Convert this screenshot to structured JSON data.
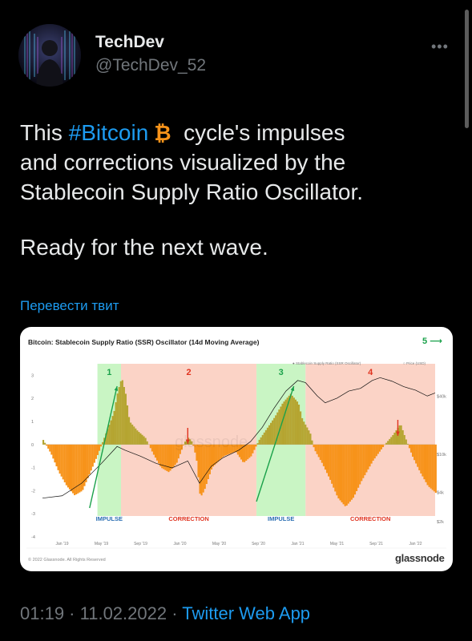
{
  "author": {
    "display_name": "TechDev",
    "handle": "@TechDev_52",
    "avatar_icon": "avatar-photo"
  },
  "tweet": {
    "line1_before": "This ",
    "hashtag": "#Bitcoin",
    "line1_after": " cycle's impulses",
    "line2": "and corrections visualized by the",
    "line3": "Stablecoin Supply Ratio Oscillator.",
    "paragraph2": "Ready for the next wave.",
    "translate_label": "Перевести твит",
    "emoji_icon": "bitcoin-icon"
  },
  "footer": {
    "time": "01:19",
    "separator": " · ",
    "date": "11.02.2022",
    "app": "Twitter Web App"
  },
  "colors": {
    "accent": "#1d9bf0",
    "impulse_bg": "#c9f5c4",
    "correction_bg": "#fbd3c6",
    "bar_orange": "#f7931a",
    "bar_olive": "#b5a531",
    "arrow_green": "#1aa14a",
    "arrow_red": "#e0321e",
    "bitcoin_orange": "#f7931a"
  },
  "chart_data": {
    "type": "area",
    "title": "Bitcoin: Stablecoin Supply Ratio (SSR) Oscillator (14d Moving Average)",
    "legend": [
      "Stablecoin Supply Ratio (SSR Oscillator)",
      "Price (USD)"
    ],
    "legend_position": "top-right",
    "y_left_ticks": [
      "3",
      "2",
      "1",
      "0",
      "-1",
      "-2",
      "-3",
      "-4"
    ],
    "y_right_ticks": [
      "$40k",
      "$10k",
      "$4k",
      "$2k"
    ],
    "x_ticks": [
      "Jan '19",
      "May '19",
      "Sep '19",
      "Jan '20",
      "May '20",
      "Sep '20",
      "Jan '21",
      "May '21",
      "Sep '21",
      "Jan '22"
    ],
    "phases": [
      {
        "number": "1",
        "label": "IMPULSE",
        "kind": "impulse",
        "x_start": 0.0,
        "x_end": 0.2
      },
      {
        "number": "2",
        "label": "CORRECTION",
        "kind": "correction",
        "x_start": 0.2,
        "x_end": 0.545
      },
      {
        "number": "3",
        "label": "IMPULSE",
        "kind": "impulse",
        "x_start": 0.545,
        "x_end": 0.67
      },
      {
        "number": "4",
        "label": "CORRECTION",
        "kind": "correction",
        "x_start": 0.67,
        "x_end": 1.0
      }
    ],
    "next_wave_label": "5",
    "oscillator": [
      [
        0.0,
        0.2
      ],
      [
        0.02,
        -0.4
      ],
      [
        0.04,
        -1.2
      ],
      [
        0.06,
        -1.8
      ],
      [
        0.08,
        -2.2
      ],
      [
        0.1,
        -2.0
      ],
      [
        0.12,
        -1.2
      ],
      [
        0.14,
        -0.4
      ],
      [
        0.16,
        0.5
      ],
      [
        0.18,
        1.4
      ],
      [
        0.19,
        2.3
      ],
      [
        0.2,
        2.9
      ],
      [
        0.21,
        2.2
      ],
      [
        0.22,
        1.0
      ],
      [
        0.24,
        0.6
      ],
      [
        0.26,
        0.3
      ],
      [
        0.28,
        -0.4
      ],
      [
        0.3,
        -1.0
      ],
      [
        0.32,
        -1.2
      ],
      [
        0.34,
        -0.8
      ],
      [
        0.36,
        0.1
      ],
      [
        0.37,
        0.3
      ],
      [
        0.38,
        0.1
      ],
      [
        0.39,
        -0.6
      ],
      [
        0.4,
        -2.3
      ],
      [
        0.41,
        -2.0
      ],
      [
        0.43,
        -1.0
      ],
      [
        0.46,
        -0.5
      ],
      [
        0.49,
        -0.3
      ],
      [
        0.51,
        -0.8
      ],
      [
        0.53,
        -0.5
      ],
      [
        0.55,
        0.2
      ],
      [
        0.57,
        0.7
      ],
      [
        0.59,
        1.2
      ],
      [
        0.61,
        1.8
      ],
      [
        0.63,
        2.2
      ],
      [
        0.65,
        1.8
      ],
      [
        0.66,
        1.1
      ],
      [
        0.68,
        0.5
      ],
      [
        0.69,
        -0.2
      ],
      [
        0.71,
        -0.8
      ],
      [
        0.73,
        -1.5
      ],
      [
        0.75,
        -2.3
      ],
      [
        0.77,
        -2.7
      ],
      [
        0.79,
        -2.3
      ],
      [
        0.81,
        -1.6
      ],
      [
        0.84,
        -0.7
      ],
      [
        0.87,
        0.0
      ],
      [
        0.89,
        0.4
      ],
      [
        0.91,
        0.9
      ],
      [
        0.92,
        0.4
      ],
      [
        0.94,
        -0.5
      ],
      [
        0.96,
        -1.2
      ],
      [
        0.98,
        -1.8
      ],
      [
        1.0,
        -2.1
      ]
    ],
    "price": [
      [
        0.0,
        3500
      ],
      [
        0.05,
        3700
      ],
      [
        0.1,
        5000
      ],
      [
        0.15,
        8000
      ],
      [
        0.19,
        12000
      ],
      [
        0.21,
        11000
      ],
      [
        0.25,
        9500
      ],
      [
        0.29,
        8000
      ],
      [
        0.33,
        7200
      ],
      [
        0.37,
        8500
      ],
      [
        0.4,
        5000
      ],
      [
        0.43,
        7500
      ],
      [
        0.46,
        9200
      ],
      [
        0.5,
        11000
      ],
      [
        0.53,
        13500
      ],
      [
        0.56,
        19000
      ],
      [
        0.59,
        30000
      ],
      [
        0.62,
        45000
      ],
      [
        0.65,
        58000
      ],
      [
        0.67,
        55000
      ],
      [
        0.7,
        40000
      ],
      [
        0.72,
        34000
      ],
      [
        0.75,
        38000
      ],
      [
        0.78,
        45000
      ],
      [
        0.81,
        48000
      ],
      [
        0.84,
        58000
      ],
      [
        0.86,
        62000
      ],
      [
        0.89,
        57000
      ],
      [
        0.92,
        50000
      ],
      [
        0.95,
        46000
      ],
      [
        0.98,
        40000
      ],
      [
        1.0,
        43000
      ]
    ],
    "y_range": [
      -4,
      3.5
    ]
  }
}
